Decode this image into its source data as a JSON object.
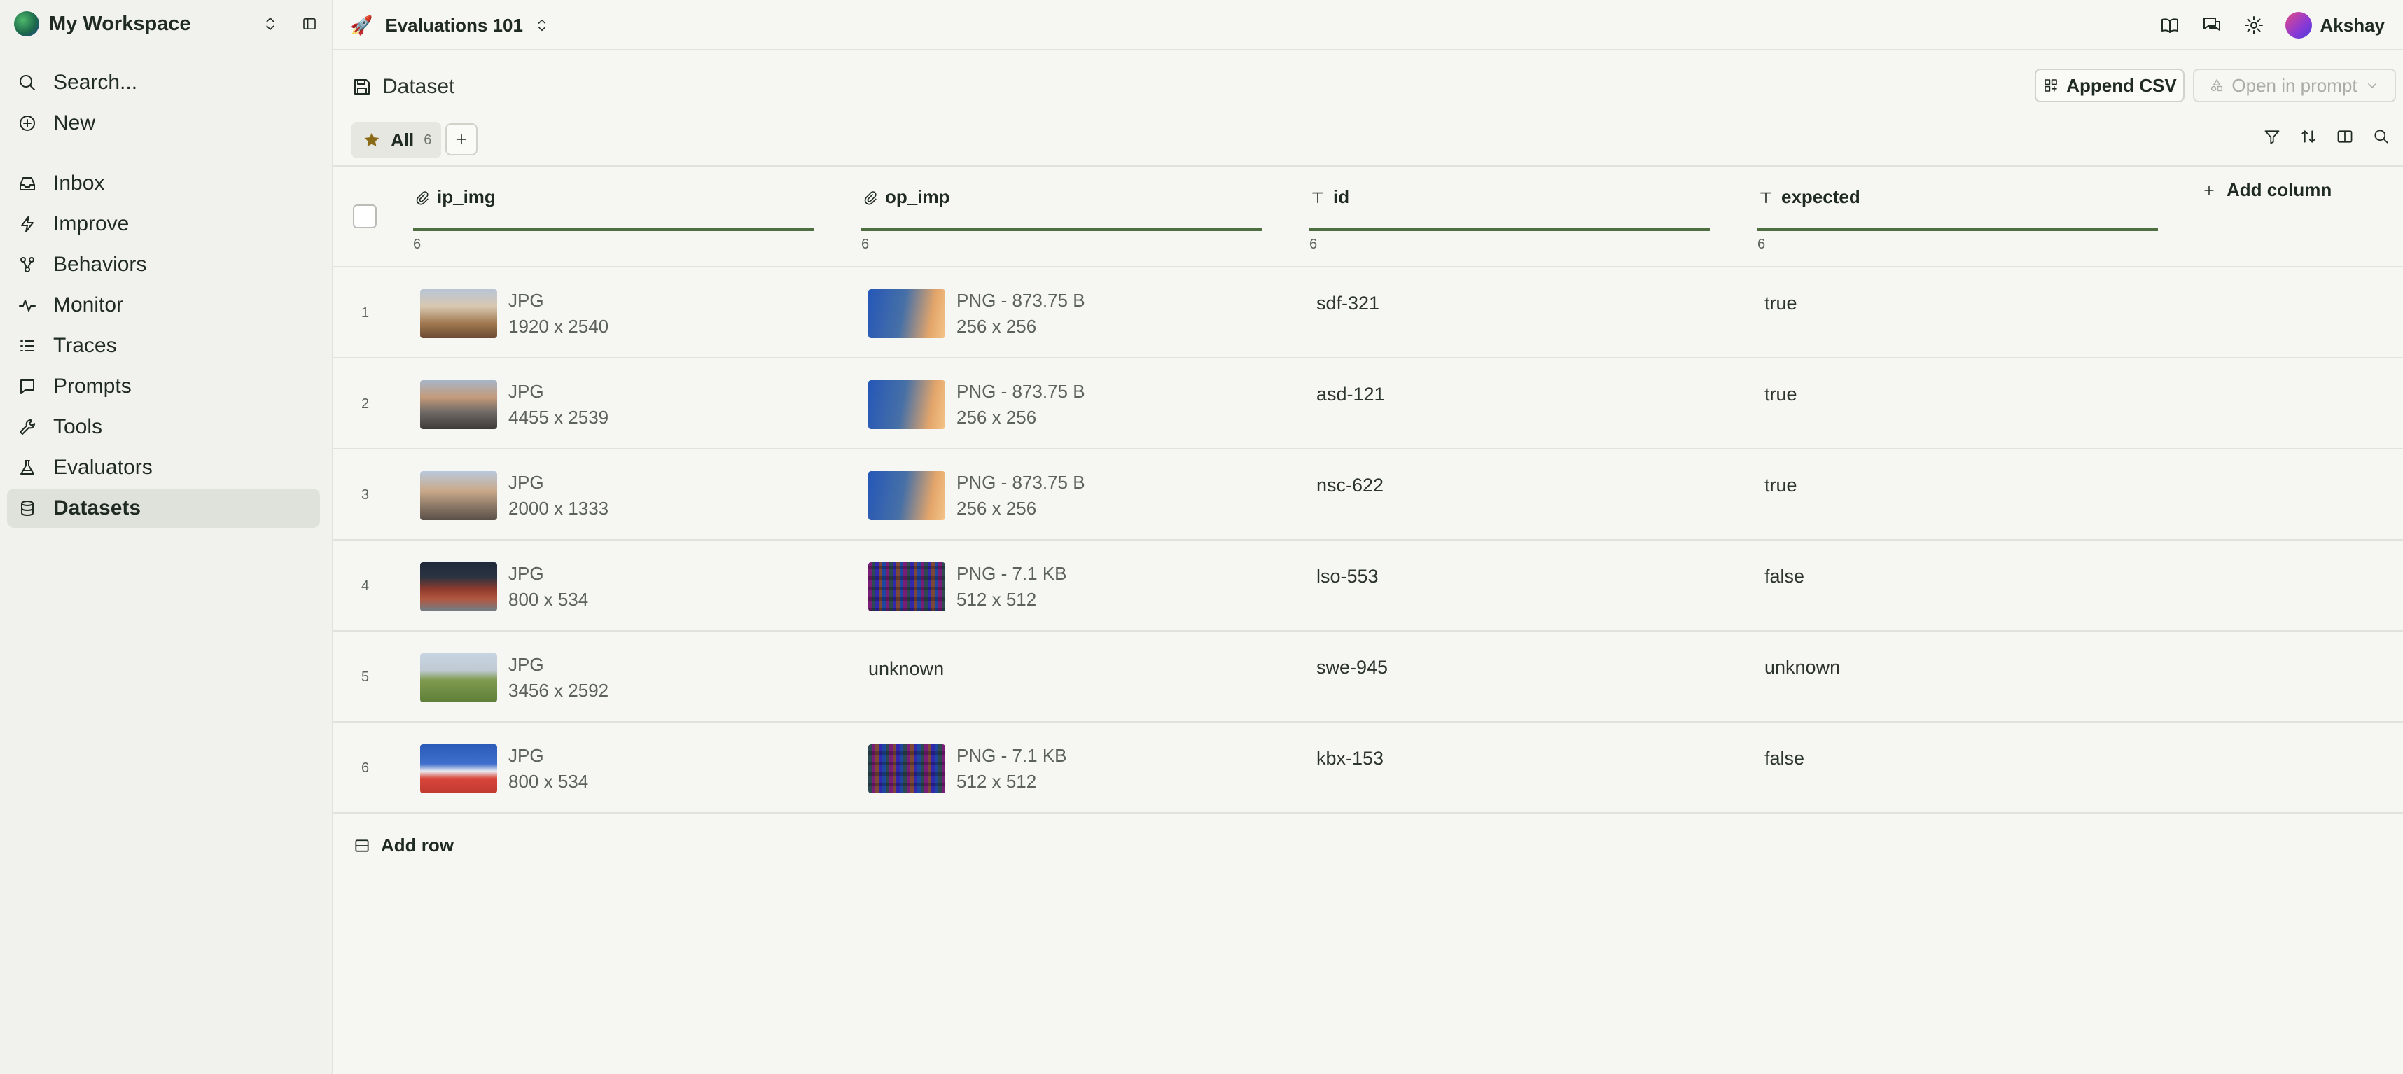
{
  "workspace": {
    "name": "My Workspace"
  },
  "sidebar": {
    "items": [
      {
        "label": "Search...",
        "icon": "search-icon"
      },
      {
        "label": "New",
        "icon": "plus-circle-icon"
      },
      {
        "label": "Inbox",
        "icon": "inbox-icon"
      },
      {
        "label": "Improve",
        "icon": "bolt-icon"
      },
      {
        "label": "Behaviors",
        "icon": "behaviors-icon"
      },
      {
        "label": "Monitor",
        "icon": "pulse-icon"
      },
      {
        "label": "Traces",
        "icon": "list-icon"
      },
      {
        "label": "Prompts",
        "icon": "chat-icon"
      },
      {
        "label": "Tools",
        "icon": "wrench-icon"
      },
      {
        "label": "Evaluators",
        "icon": "flask-icon"
      },
      {
        "label": "Datasets",
        "icon": "database-icon",
        "active": true
      }
    ]
  },
  "topbar": {
    "project": "Evaluations 101",
    "project_icon": "rocket",
    "user": "Akshay"
  },
  "page": {
    "title": "Dataset",
    "append_csv": "Append CSV",
    "open_in_prompt": "Open in prompt",
    "tab_all": "All",
    "tab_all_count": "6",
    "add_column": "Add column",
    "add_row": "Add row"
  },
  "table": {
    "columns": [
      {
        "name": "ip_img",
        "type": "attachment",
        "count": "6"
      },
      {
        "name": "op_imp",
        "type": "attachment",
        "count": "6"
      },
      {
        "name": "id",
        "type": "text",
        "count": "6"
      },
      {
        "name": "expected",
        "type": "text",
        "count": "6"
      }
    ],
    "rows": [
      {
        "index": "1",
        "ip_format": "JPG",
        "ip_dims": "1920 x 2540",
        "op_format": "PNG - 873.75 B",
        "op_dims": "256 x 256",
        "op_thumb": "gradient",
        "id": "sdf-321",
        "expected": "true"
      },
      {
        "index": "2",
        "ip_format": "JPG",
        "ip_dims": "4455 x 2539",
        "op_format": "PNG - 873.75 B",
        "op_dims": "256 x 256",
        "op_thumb": "gradient",
        "id": "asd-121",
        "expected": "true"
      },
      {
        "index": "3",
        "ip_format": "JPG",
        "ip_dims": "2000 x 1333",
        "op_format": "PNG - 873.75 B",
        "op_dims": "256 x 256",
        "op_thumb": "gradient",
        "id": "nsc-622",
        "expected": "true"
      },
      {
        "index": "4",
        "ip_format": "JPG",
        "ip_dims": "800 x 534",
        "op_format": "PNG - 7.1 KB",
        "op_dims": "512 x 512",
        "op_thumb": "noise",
        "id": "lso-553",
        "expected": "false"
      },
      {
        "index": "5",
        "ip_format": "JPG",
        "ip_dims": "3456 x 2592",
        "op_value": "unknown",
        "op_thumb": "none",
        "id": "swe-945",
        "expected": "unknown"
      },
      {
        "index": "6",
        "ip_format": "JPG",
        "ip_dims": "800 x 534",
        "op_format": "PNG - 7.1 KB",
        "op_dims": "512 x 512",
        "op_thumb": "noise",
        "id": "kbx-153",
        "expected": "false"
      }
    ]
  },
  "colors": {
    "accent": "#4f6e41",
    "active_nav": "#dfe2db",
    "background": "#f6f6f2"
  }
}
